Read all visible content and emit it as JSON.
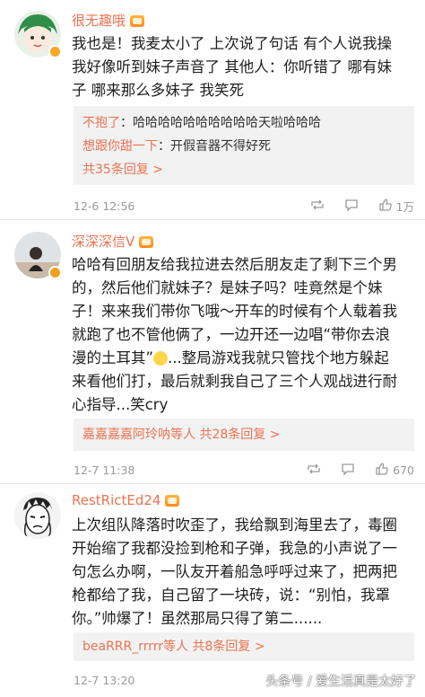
{
  "comments": [
    {
      "username": "很无趣哦",
      "text": "我也是！我麦太小了 上次说了句话 有个人说我操\n我好像听到妹子声音了 其他人：你听错了 哪有妹\n子 哪来那么多妹子 我笑死",
      "replies": [
        {
          "name": "不抱了",
          "text": "哈哈哈哈哈哈哈哈哈哈天啦哈哈哈"
        },
        {
          "name": "想跟你甜一下",
          "text": "开假音器不得好死"
        }
      ],
      "more_replies": "共35条回复 >",
      "time": "12-6 12:56",
      "likes": "1万"
    },
    {
      "username": "深深深信V",
      "text_before_emoji": "哈哈有回朋友给我拉进去然后朋友走了剩下三个男\n的，然后他们就妹子？是妹子吗？哇竟然是个妹\n子！来来我们带你飞哦～开车的时候有个人载着我\n就跑了也不管他俩了，一边开还一边唱“带你去浪\n漫的土耳其”",
      "text_after_emoji": "...整局游戏我就只管找个地方躲起\n来看他们打，最后就剩我自己了三个人观战进行耐\n心指导...笑cry",
      "reply_summary_names": "嘉嘉嘉嘉阿玲呐等人",
      "more_replies": "共28条回复 >",
      "time": "12-7 11:38",
      "likes": "670"
    },
    {
      "username": "RestRictEd24",
      "text": "上次组队降落时吹歪了，我给飘到海里去了，毒圈\n开始缩了我都没捡到枪和子弹，我急的小声说了一\n句怎么办啊，一队友开着船急呼呼过来了，把两把\n枪都给了我，自己留了一块砖，说：“别怕，我罩\n你。”帅爆了！虽然那局只得了第二......",
      "reply_summary_names": "beaRRR_rrrrr等人",
      "more_replies": "共8条回复 >",
      "time": "12-7 13:20",
      "likes": ""
    }
  ],
  "watermark": "头条号 / 爱生活真是太好了",
  "colors": {
    "accent": "#eb7350",
    "reply_bg": "#f2f2f2",
    "meta": "#9a9a9a"
  },
  "icons": [
    "v-badge-icon",
    "level-badge-icon",
    "repost-icon",
    "comment-icon",
    "like-icon",
    "laugh-emoji-icon"
  ]
}
